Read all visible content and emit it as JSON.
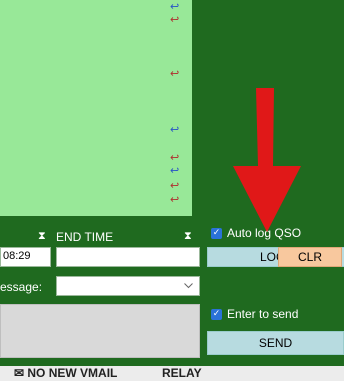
{
  "green_panel": {
    "return_glyph": "↩"
  },
  "end_time_label": "END TIME",
  "hourglass_icon": "⧗",
  "time_value": "08:29",
  "end_time_value": "",
  "message_label": "essage:",
  "auto_log": {
    "label": "Auto log QSO",
    "checked": true
  },
  "buttons": {
    "log": "LOG",
    "clr": "CLR",
    "send": "SEND"
  },
  "enter_to_send": {
    "label": "Enter to send",
    "checked": true
  },
  "status": {
    "vmail": "✉ NO NEW VMAIL",
    "relay": "RELAY"
  },
  "colors": {
    "background": "#1f6a1f",
    "panel": "#98e898",
    "clr_button": "#f8c89e",
    "arrow": "#e01818"
  }
}
